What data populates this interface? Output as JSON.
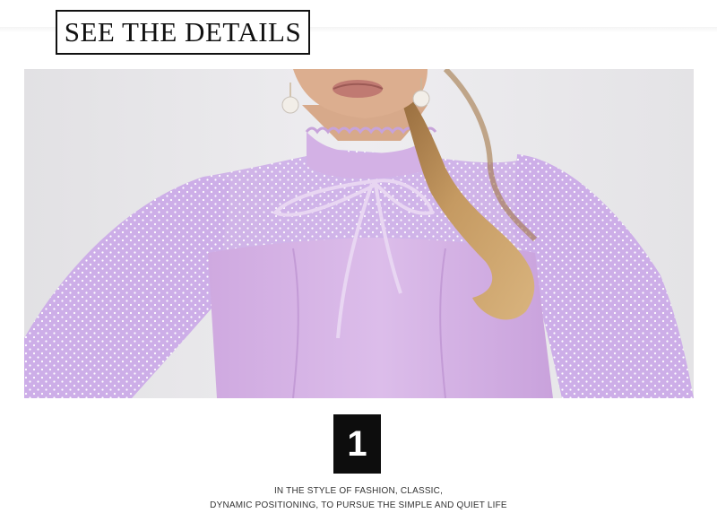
{
  "heading": "SEE THE DETAILS",
  "detail_number": "1",
  "caption": {
    "line1": "IN THE STYLE OF FASHION, CLASSIC,",
    "line2": "DYNAMIC POSITIONING, TO PURSUE THE SIMPLE AND QUIET LIFE"
  },
  "photo": {
    "subject": "product-detail-photo",
    "colors": {
      "dress": "#d6b6e6",
      "sleeve": "#cfb0e8",
      "skin": "#dcae8f",
      "hair": "#b58a55",
      "background": "#e9e8eb"
    }
  }
}
